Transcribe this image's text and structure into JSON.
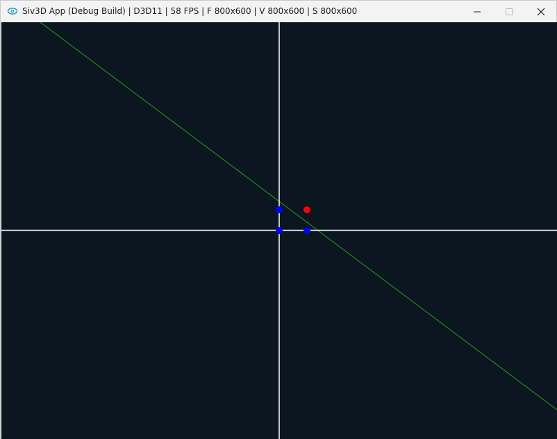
{
  "window": {
    "title": "Siv3D App (Debug Build) | D3D11 | 58 FPS | F 800x600 | V 800x600 | S 800x600",
    "icon": "siv3d-eye-icon",
    "controls": {
      "minimize_icon": "minimize-icon",
      "maximize_icon": "maximize-icon",
      "close_icon": "close-icon"
    }
  },
  "scene": {
    "background_color": "#0b1620",
    "axis_color": "#ffffff",
    "line_color": "#1f8a1f",
    "blue_point_color": "#0000ff",
    "red_point_color": "#ff0000"
  }
}
